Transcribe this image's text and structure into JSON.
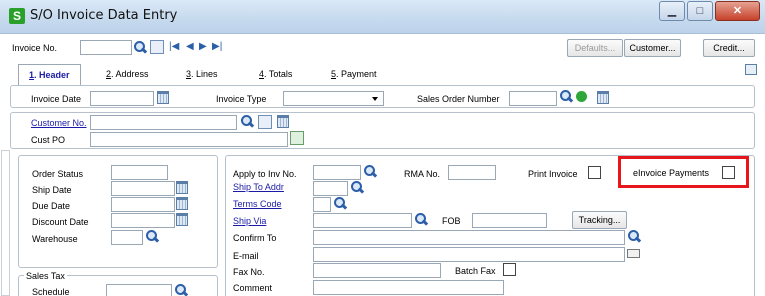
{
  "window": {
    "title": "S/O Invoice Data Entry",
    "logo_letter": "S"
  },
  "toolbar": {
    "invoice_no_label": "Invoice No.",
    "invoice_no_value": "",
    "defaults_label": "Defaults...",
    "customer_label": "Customer...",
    "credit_label": "Credit..."
  },
  "tabs": [
    {
      "num": "1",
      "label": ". Header",
      "active": true
    },
    {
      "num": "2",
      "label": ". Address",
      "active": false
    },
    {
      "num": "3",
      "label": ". Lines",
      "active": false
    },
    {
      "num": "4",
      "label": ". Totals",
      "active": false
    },
    {
      "num": "5",
      "label": ". Payment",
      "active": false
    }
  ],
  "header": {
    "invoice_date_label": "Invoice Date",
    "invoice_date_value": "",
    "invoice_type_label": "Invoice Type",
    "invoice_type_value": "",
    "sales_order_number_label": "Sales Order Number",
    "sales_order_number_value": ""
  },
  "customer": {
    "customer_no_label": "Customer No.",
    "customer_no_value": "",
    "cust_po_label": "Cust PO",
    "cust_po_value": ""
  },
  "left_panel": {
    "order_status_label": "Order Status",
    "ship_date_label": "Ship Date",
    "due_date_label": "Due Date",
    "discount_date_label": "Discount Date",
    "warehouse_label": "Warehouse",
    "sales_tax_label": "Sales Tax",
    "schedule_label": "Schedule"
  },
  "right_panel": {
    "apply_to_inv_label": "Apply to Inv No.",
    "rma_no_label": "RMA No.",
    "print_invoice_label": "Print Invoice",
    "print_invoice_checked": false,
    "einvoice_payments_label": "eInvoice Payments",
    "einvoice_payments_checked": false,
    "ship_to_addr_label": "Ship To Addr",
    "terms_code_label": "Terms Code",
    "ship_via_label": "Ship Via",
    "fob_label": "FOB",
    "tracking_label": "Tracking...",
    "confirm_to_label": "Confirm To",
    "email_label": "E-mail",
    "fax_no_label": "Fax No.",
    "batch_fax_label": "Batch Fax",
    "batch_fax_checked": false,
    "comment_label": "Comment"
  },
  "colors": {
    "highlight": "#e8161b",
    "link": "#1a1aa6",
    "accent": "#2d5fa8"
  }
}
